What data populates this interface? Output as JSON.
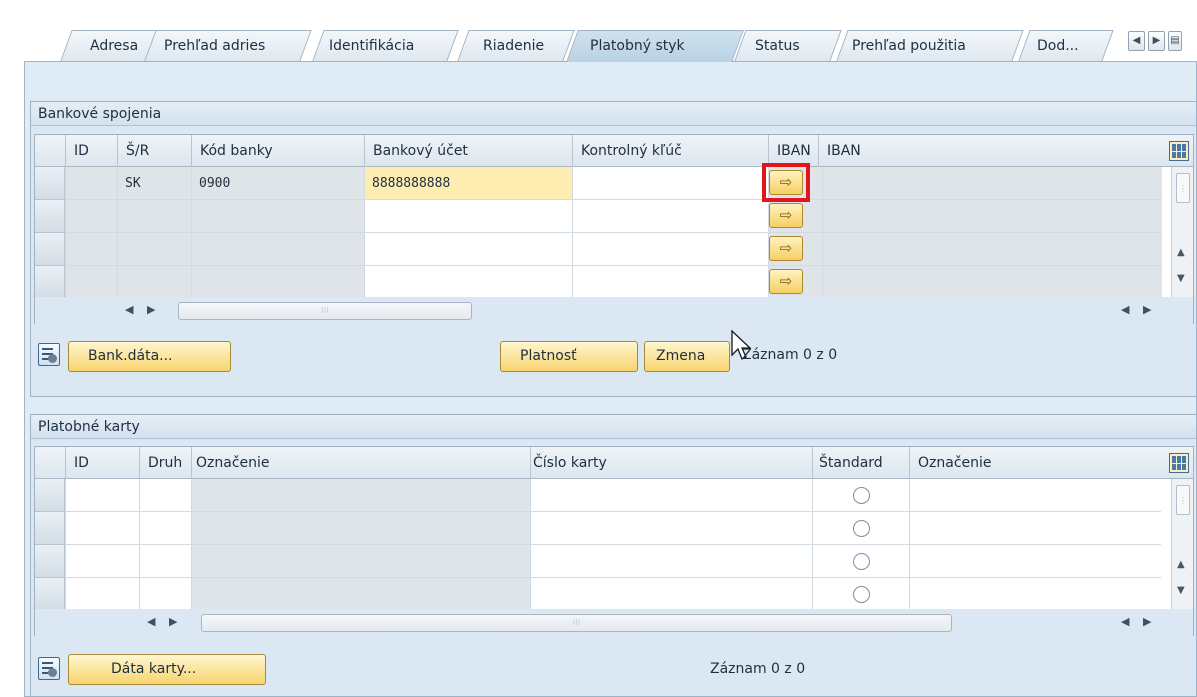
{
  "tabs": [
    {
      "label": "Adresa"
    },
    {
      "label": "Prehľad adries"
    },
    {
      "label": "Identifikácia"
    },
    {
      "label": "Riadenie"
    },
    {
      "label": "Platobný styk"
    },
    {
      "label": "Status"
    },
    {
      "label": "Prehľad použitia"
    },
    {
      "label": "Dod..."
    }
  ],
  "active_tab": "Platobný styk",
  "bank": {
    "title": "Bankové spojenia",
    "headers": [
      "ID",
      "Š/R",
      "Kód banky",
      "Bankový účet",
      "Kontrolný kľúč",
      "IBAN",
      "IBAN"
    ],
    "rows": [
      {
        "id": "",
        "country": "SK",
        "bank_code": "0900",
        "account": "8888888888",
        "key": ""
      },
      {
        "id": "",
        "country": "",
        "bank_code": "",
        "account": "",
        "key": ""
      },
      {
        "id": "",
        "country": "",
        "bank_code": "",
        "account": "",
        "key": ""
      },
      {
        "id": "",
        "country": "",
        "bank_code": "",
        "account": "",
        "key": ""
      }
    ],
    "btn_bank_data": "Bank.dáta...",
    "btn_validity": "Platnosť",
    "btn_change": "Zmena",
    "record_status": "Záznam 0 z 0"
  },
  "cards": {
    "title": "Platobné karty",
    "headers": [
      "ID",
      "Druh",
      "Označenie",
      "Číslo karty",
      "Štandard",
      "Označenie"
    ],
    "btn_card_data": "Dáta karty...",
    "record_status": "Záznam 0 z 0"
  },
  "icons": {
    "iban_button": "arrow-to-document-icon",
    "column_config": "column-config-icon",
    "detail": "detail-view-icon",
    "mouse_cursor": "mouse-pointer-icon"
  },
  "colors": {
    "button_fill": "#f7d46e",
    "input_highlight": "#fdedb1",
    "highlight_frame": "#e2161a",
    "panel_bg": "#dfebf5"
  }
}
